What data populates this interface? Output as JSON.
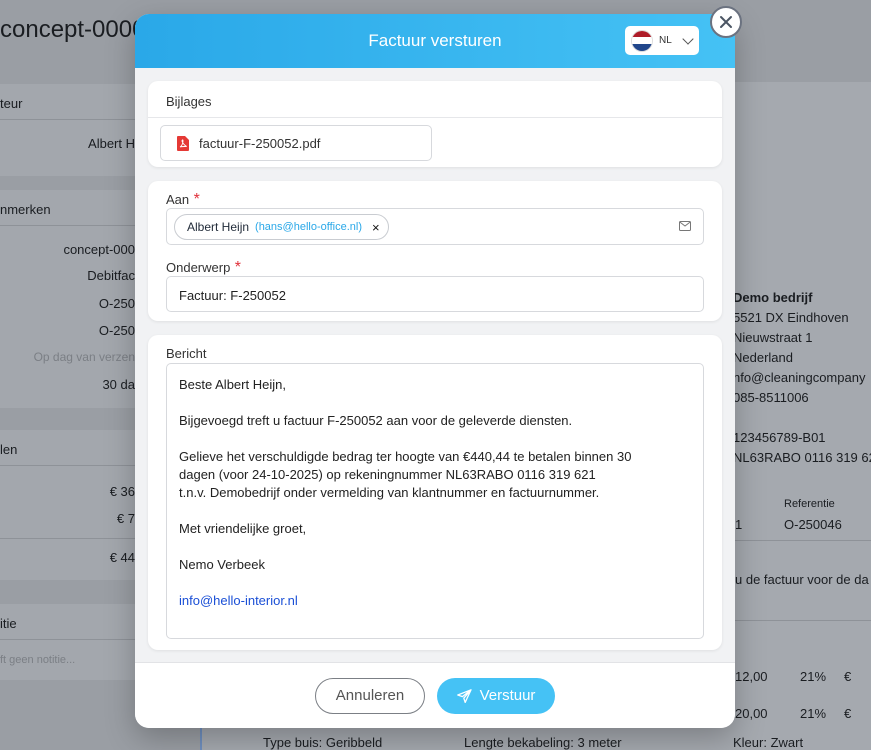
{
  "background": {
    "page_title": "concept-0000",
    "left_cards": [
      {
        "header": "teur",
        "lines": [
          "Albert H"
        ]
      },
      {
        "header": "nmerken",
        "lines": [
          "concept-000",
          "Debitfac",
          "O-250",
          "O-250",
          "Op dag van verzen",
          "30 da"
        ]
      },
      {
        "header": "len",
        "lines": [
          "€ 36",
          "€ 7",
          "€ 44"
        ]
      },
      {
        "header": "itie",
        "lines": [
          "ft geen notitie..."
        ]
      }
    ],
    "company": {
      "name": "Demo bedrijf",
      "lines": [
        "5521 DX Eindhoven",
        "Nieuwstraat 1",
        "Nederland",
        "nfo@cleaningcompany",
        "085-8511006",
        "",
        "123456789-B01",
        "NL63RABO 0116 319 621"
      ]
    },
    "ref_label": "Referentie",
    "ref_value": "O-250046",
    "ref_left": "1",
    "body_snippet": "u de factuur voor de da",
    "rows": [
      {
        "a": "12,00",
        "b": "21%",
        "c": "€"
      },
      {
        "a": "20,00",
        "b": "21%",
        "c": "€"
      }
    ],
    "bottom_line": [
      "Type buis: Geribbeld",
      "Lengte bekabeling: 3 meter",
      "Kleur: Zwart"
    ]
  },
  "modal": {
    "title": "Factuur versturen",
    "language": "NL",
    "flag_colors": [
      "#ae1c28",
      "#ffffff",
      "#21468b"
    ],
    "attachments_label": "Bijlages",
    "attachment_file": "factuur-F-250052.pdf",
    "to_label": "Aan",
    "recipient_name": "Albert Heijn",
    "recipient_email": "(hans@hello-office.nl)",
    "remove_symbol": "×",
    "subject_label": "Onderwerp",
    "subject_value": "Factuur: F-250052",
    "message_label": "Bericht",
    "message": {
      "greeting": "Beste Albert Heijn,",
      "p1": "Bijgevoegd treft u factuur F-250052 aan voor de geleverde diensten.",
      "p2": "Gelieve het verschuldigde bedrag ter hoogte van €440,44 te betalen binnen 30\ndagen (voor 24-10-2025) op rekeningnummer NL63RABO 0116 319 621\nt.n.v. Demobedrijf onder vermelding van klantnummer en factuurnummer.",
      "closing": "Met vriendelijke groet,",
      "sender": "Nemo Verbeek",
      "email": "info@hello-interior.nl"
    },
    "required_mark": "*",
    "cancel_label": "Annuleren",
    "send_label": "Verstuur"
  }
}
